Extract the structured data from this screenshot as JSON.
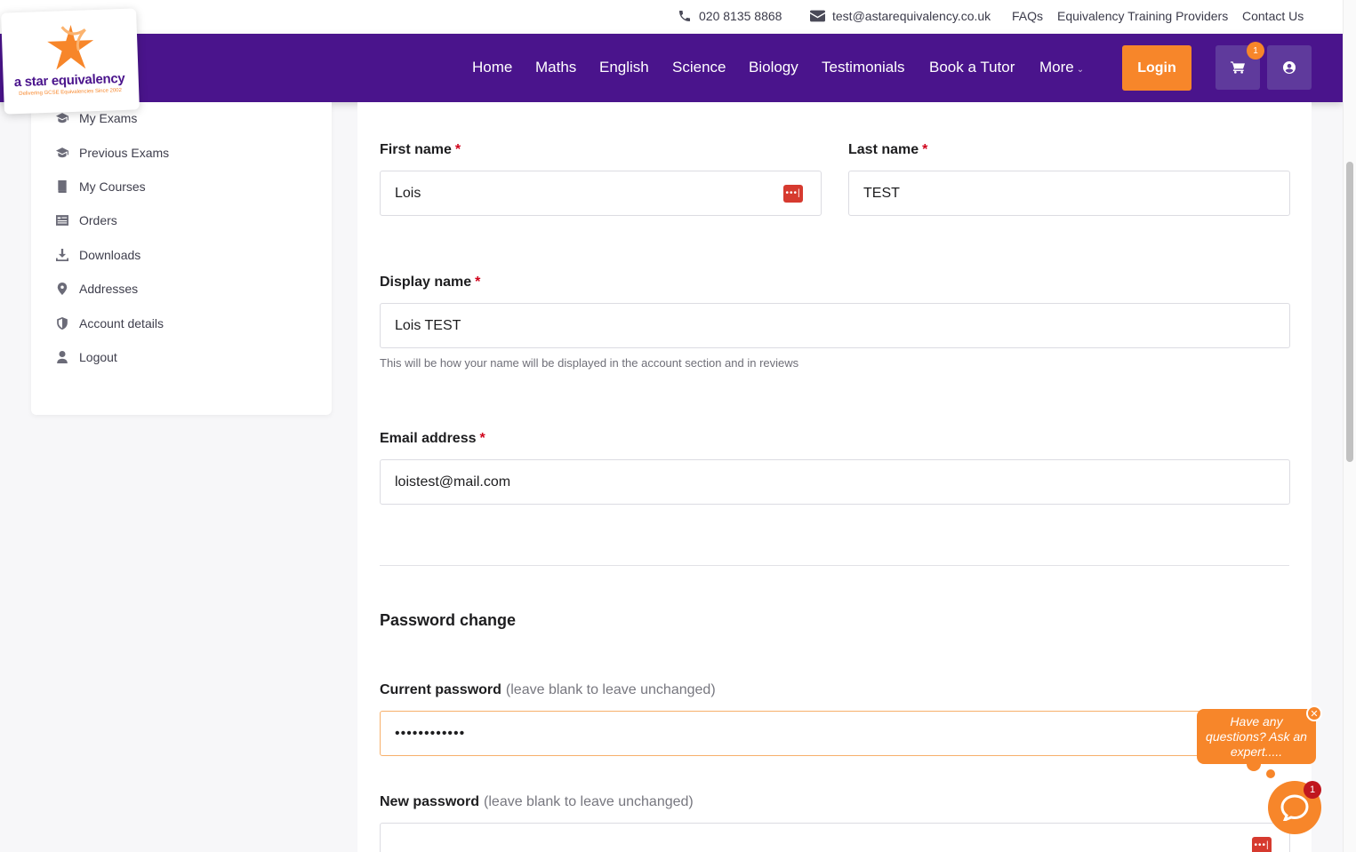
{
  "topbar": {
    "phone": "020 8135 8868",
    "email": "test@astarequivalency.co.uk",
    "links": [
      "FAQs",
      "Equivalency Training Providers",
      "Contact Us"
    ]
  },
  "logo": {
    "name": "a star equivalency",
    "tagline": "Delivering GCSE Equivalencies Since 2002"
  },
  "nav": {
    "items": [
      "Home",
      "Maths",
      "English",
      "Science",
      "Biology",
      "Testimonials",
      "Book a Tutor",
      "More"
    ],
    "login_label": "Login",
    "cart_count": "1"
  },
  "sidebar": {
    "items": [
      {
        "label": "My Exams",
        "icon": "graduation-cap-icon"
      },
      {
        "label": "Previous Exams",
        "icon": "graduation-cap-icon"
      },
      {
        "label": "My Courses",
        "icon": "book-icon"
      },
      {
        "label": "Orders",
        "icon": "receipt-icon"
      },
      {
        "label": "Downloads",
        "icon": "download-icon"
      },
      {
        "label": "Addresses",
        "icon": "map-pin-icon"
      },
      {
        "label": "Account details",
        "icon": "shield-icon"
      },
      {
        "label": "Logout",
        "icon": "user-icon"
      }
    ]
  },
  "form": {
    "first_name": {
      "label": "First name",
      "required": "*",
      "value": "Lois"
    },
    "last_name": {
      "label": "Last name",
      "required": "*",
      "value": "TEST"
    },
    "display_name": {
      "label": "Display name",
      "required": "*",
      "value": "Lois TEST",
      "help": "This will be how your name will be displayed in the account section and in reviews"
    },
    "email": {
      "label": "Email address",
      "required": "*",
      "value": "loistest@mail.com"
    },
    "password_section_title": "Password change",
    "current_password": {
      "label": "Current password",
      "hint": "(leave blank to leave unchanged)",
      "value": "••••••••••••"
    },
    "new_password": {
      "label": "New password",
      "hint": "(leave blank to leave unchanged)",
      "value": ""
    }
  },
  "chat": {
    "prompt": "Have any questions? Ask an expert.....",
    "close": "✕",
    "badge": "1"
  },
  "colors": {
    "brand_purple": "#4a148c",
    "accent_orange": "#f7862a"
  }
}
